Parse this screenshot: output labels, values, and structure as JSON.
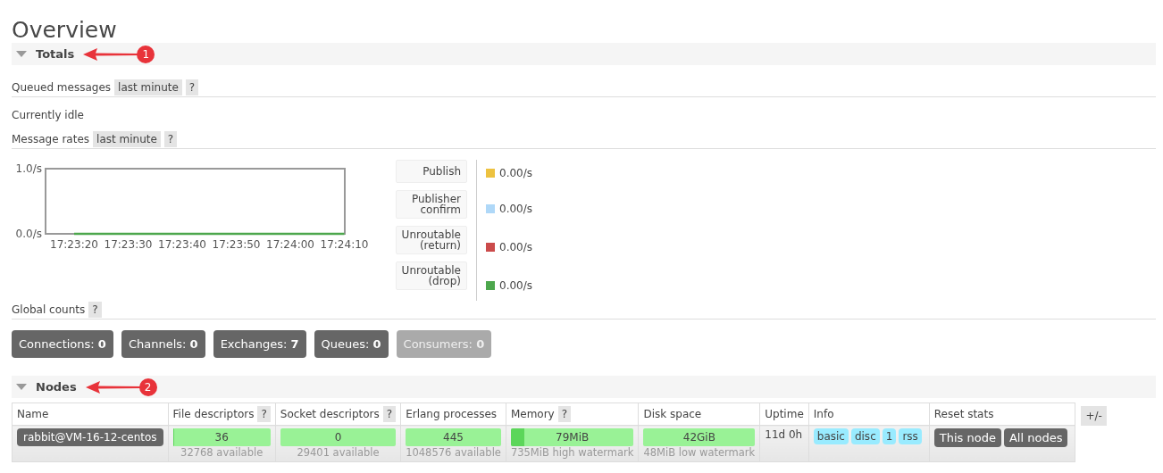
{
  "title": "Overview",
  "totals": {
    "heading": "Totals",
    "expanded": true,
    "annotation": "1",
    "queued": {
      "label": "Queued messages",
      "range": "last minute",
      "help": "?"
    },
    "idle": "Currently idle",
    "rates": {
      "label": "Message rates",
      "range": "last minute",
      "help": "?"
    },
    "chart_data": {
      "type": "line",
      "x": [
        "17:23:20",
        "17:23:30",
        "17:23:40",
        "17:23:50",
        "17:24:00",
        "17:24:10"
      ],
      "ylim": [
        0,
        1
      ],
      "yticks": [
        {
          "value": 0,
          "label": "0.0/s"
        },
        {
          "value": 1,
          "label": "1.0/s"
        }
      ],
      "series": [
        {
          "color": "#4da74d",
          "values": [
            0,
            0,
            0,
            0,
            0,
            0
          ]
        }
      ]
    },
    "legend": [
      {
        "label": "Publish",
        "color": "#edc240",
        "reading": "0.00/s"
      },
      {
        "label": "Publisher confirm",
        "color": "#afd8f8",
        "reading": "0.00/s"
      },
      {
        "label": "Unroutable (return)",
        "color": "#cb4b4b",
        "reading": "0.00/s"
      },
      {
        "label": "Unroutable (drop)",
        "color": "#4da74d",
        "reading": "0.00/s"
      }
    ],
    "global": {
      "label": "Global counts",
      "help": "?"
    },
    "counts": [
      {
        "label": "Connections:",
        "count": "0",
        "disabled": false
      },
      {
        "label": "Channels:",
        "count": "0",
        "disabled": false
      },
      {
        "label": "Exchanges:",
        "count": "7",
        "disabled": false
      },
      {
        "label": "Queues:",
        "count": "0",
        "disabled": false
      },
      {
        "label": "Consumers:",
        "count": "0",
        "disabled": true
      }
    ]
  },
  "nodes": {
    "heading": "Nodes",
    "expanded": true,
    "annotation": "2",
    "columns": [
      {
        "label": "Name",
        "help": false
      },
      {
        "label": "File descriptors",
        "help": true
      },
      {
        "label": "Socket descriptors",
        "help": true
      },
      {
        "label": "Erlang processes",
        "help": false
      },
      {
        "label": "Memory",
        "help": true
      },
      {
        "label": "Disk space",
        "help": false
      },
      {
        "label": "Uptime",
        "help": false
      },
      {
        "label": "Info",
        "help": false
      },
      {
        "label": "Reset stats",
        "help": false
      }
    ],
    "help": "?",
    "toggle": "+/-",
    "rows": [
      {
        "name": "rabbit@VM-16-12-centos",
        "bars": [
          {
            "value": "36",
            "level": 0.001,
            "sub": "32768 available"
          },
          {
            "value": "0",
            "level": 0,
            "sub": "29401 available"
          },
          {
            "value": "445",
            "level": 0.0004,
            "sub": "1048576 available"
          },
          {
            "value": "79MiB",
            "level": 0.107,
            "sub": "735MiB high watermark"
          },
          {
            "value": "42GiB",
            "level": 0,
            "sub": "48MiB low watermark"
          }
        ],
        "uptime": "11d 0h",
        "info": [
          "basic",
          "disc",
          "1",
          "rss"
        ],
        "reset": [
          "This node",
          "All nodes"
        ]
      }
    ]
  }
}
